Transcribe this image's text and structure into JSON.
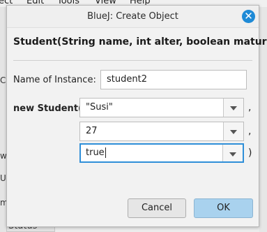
{
  "background": {
    "menu": [
      "ect",
      "Edit",
      "Tools",
      "View",
      "Help"
    ],
    "fragments": [
      "C",
      "w",
      "U",
      "m"
    ],
    "status": "Status"
  },
  "dialog": {
    "title": "BlueJ:  Create Object",
    "close_icon": "close-icon",
    "signature": "Student(String name, int alter, boolean matura)",
    "instance_label": "Name of Instance:",
    "instance_value": "student2",
    "constructor_label": "new Student(",
    "params": [
      {
        "value": "\"Susi\"",
        "suffix": ","
      },
      {
        "value": "27",
        "suffix": ","
      },
      {
        "value": "true",
        "suffix": ")"
      }
    ],
    "cancel_label": "Cancel",
    "ok_label": "OK"
  }
}
